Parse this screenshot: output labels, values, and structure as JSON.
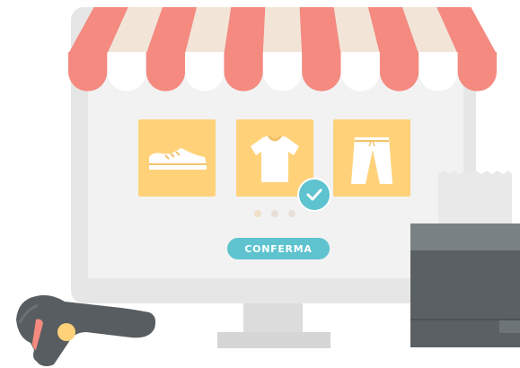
{
  "shop": {
    "products": [
      {
        "icon": "sneaker-icon"
      },
      {
        "icon": "tshirt-icon",
        "selected": true
      },
      {
        "icon": "trousers-icon"
      }
    ],
    "carousel": {
      "pages": 3,
      "active": 1
    },
    "confirm_label": "CONFERMA"
  },
  "colors": {
    "awning_red": "#f48a80",
    "awning_cream": "#f2e5d8",
    "tile": "#ffd27a",
    "accent": "#5ec3cf",
    "dot_active": "#efe0c8",
    "dot_inactive": "#e8e0d6",
    "register": "#5a6063"
  }
}
